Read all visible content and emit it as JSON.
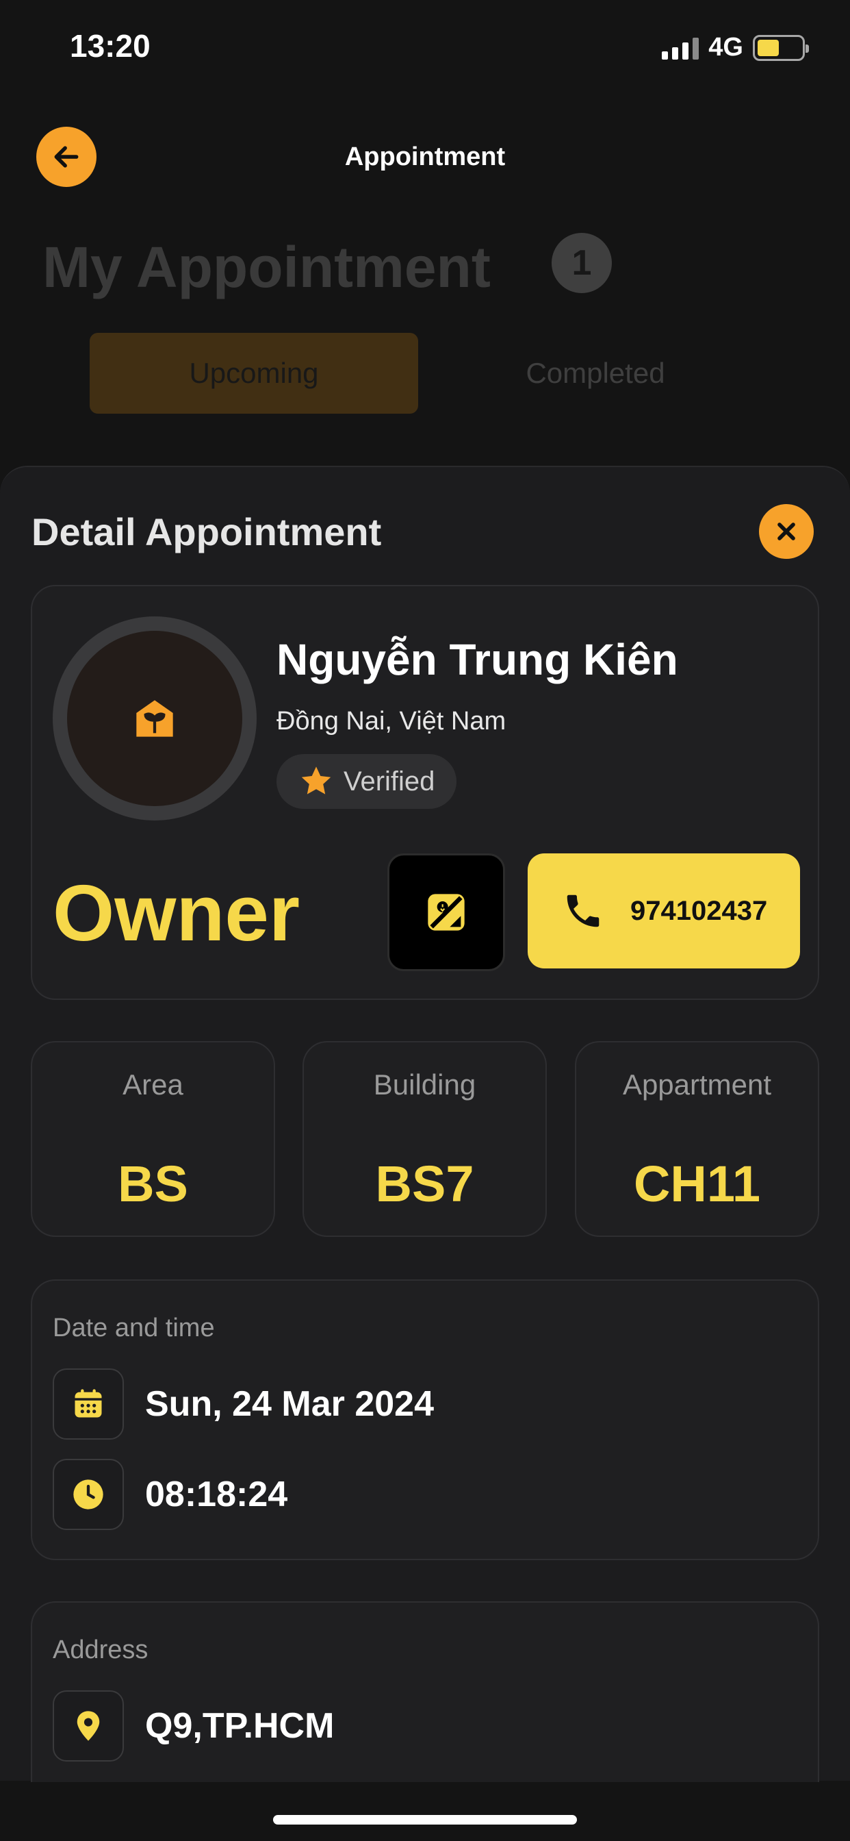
{
  "status_bar": {
    "time": "13:20",
    "network": "4G",
    "battery_color": "#f6d84a"
  },
  "header": {
    "title": "Appointment",
    "back_icon": "arrow-left-icon"
  },
  "background": {
    "heading": "My Appointment",
    "count": "1",
    "tabs": [
      {
        "label": "Upcoming",
        "active": true
      },
      {
        "label": "Completed",
        "active": false
      }
    ]
  },
  "detail": {
    "title": "Detail Appointment",
    "close_icon": "close-icon",
    "owner": {
      "name": "Nguyễn Trung Kiên",
      "location": "Đồng Nai, Việt Nam",
      "verified_label": "Verified",
      "role": "Owner",
      "phone": "974102437",
      "avatar_icon": "home-plant-icon"
    },
    "info": [
      {
        "label": "Area",
        "value": "BS"
      },
      {
        "label": "Building",
        "value": "BS7"
      },
      {
        "label": "Appartment",
        "value": "CH11"
      }
    ],
    "datetime": {
      "label": "Date and time",
      "date": "Sun, 24 Mar 2024",
      "time": "08:18:24"
    },
    "address": {
      "label": "Address",
      "value": "Q9,TP.HCM"
    }
  },
  "colors": {
    "accent_orange": "#f7a22b",
    "accent_yellow": "#f6d84a",
    "sheet_bg": "#1c1c1e"
  }
}
